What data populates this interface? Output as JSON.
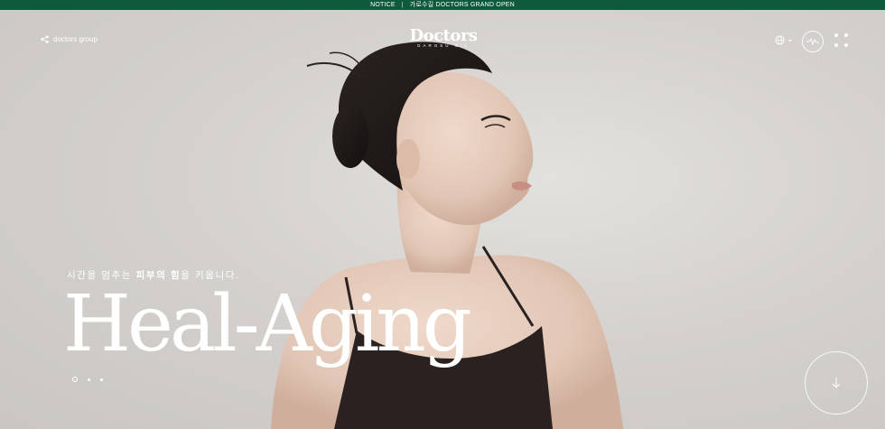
{
  "notice": {
    "label": "NOTICE",
    "separator": "|",
    "text": "가로수길 DOCTORS GRAND OPEN"
  },
  "header": {
    "group_link": "doctors group",
    "logo": {
      "word": "Doctors",
      "sub": "GAROSU GIL"
    }
  },
  "hero": {
    "tagline_pre": "시간을 멈추는 ",
    "tagline_bold": "피부의 힘",
    "tagline_post": "을 키웁니다.",
    "headline": "Heal-Aging"
  },
  "slider": {
    "count": 3,
    "active_index": 0
  },
  "colors": {
    "notice_bg": "#0f5a3c",
    "text": "#ffffff",
    "background": "#d3d0cd"
  },
  "icons": [
    "share-icon",
    "globe-icon",
    "caret-down-icon",
    "wave-icon",
    "menu-grid-icon",
    "arrow-down-icon"
  ]
}
